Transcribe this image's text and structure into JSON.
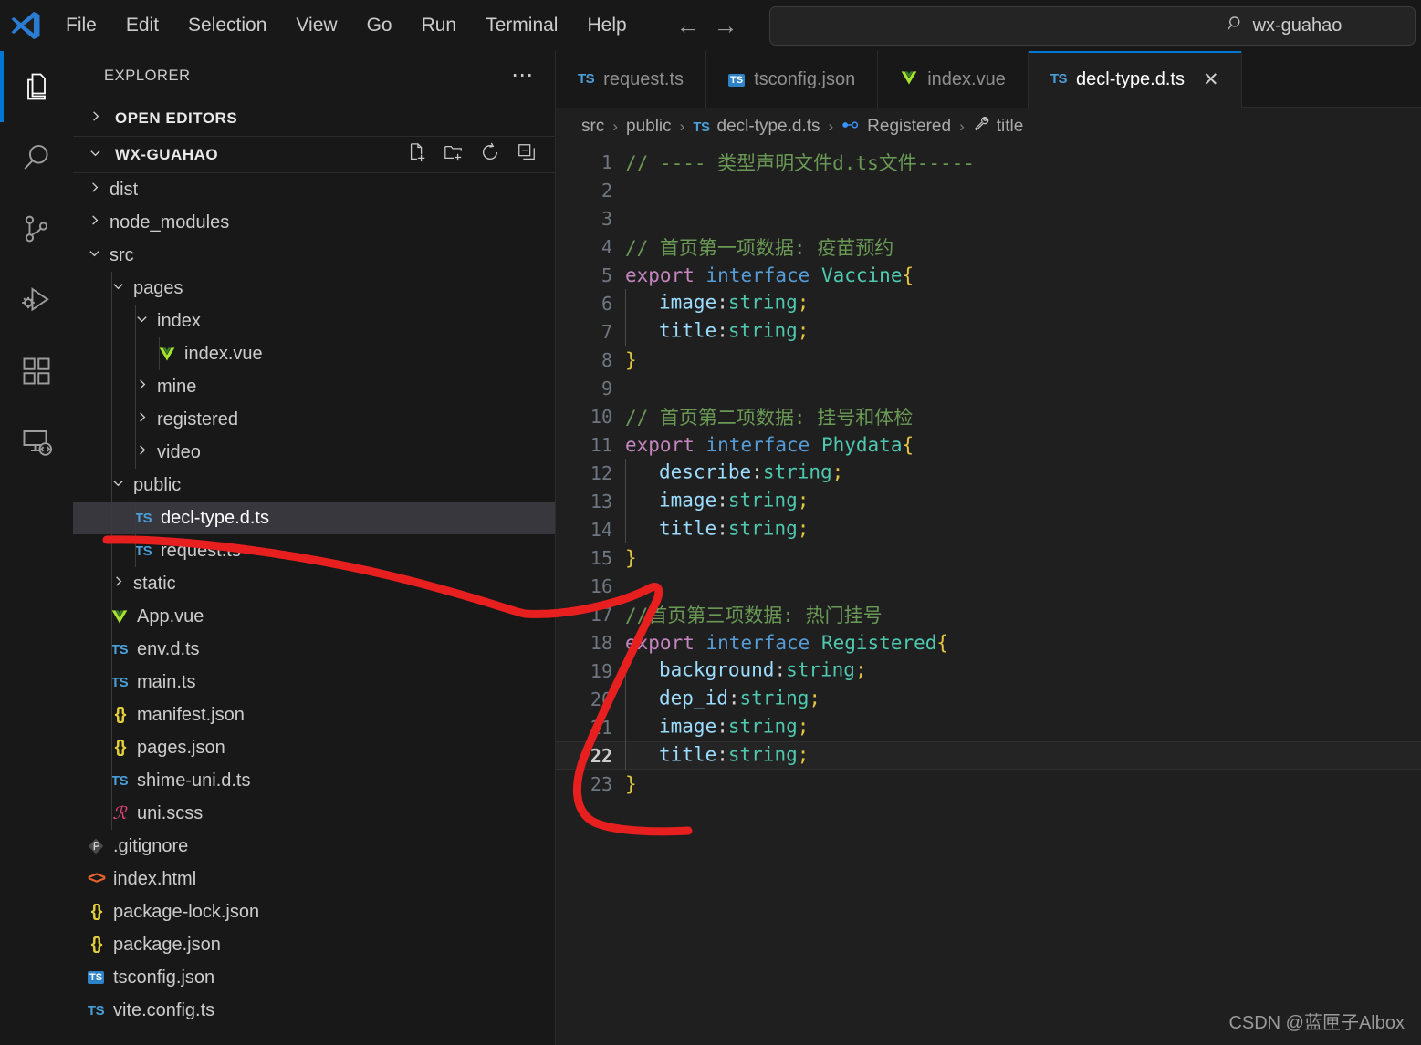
{
  "titlebar": {
    "logo_icon": "vscode-logo-icon",
    "menu": [
      "File",
      "Edit",
      "Selection",
      "View",
      "Go",
      "Run",
      "Terminal",
      "Help"
    ],
    "back_icon": "arrow-left-icon",
    "forward_icon": "arrow-right-icon",
    "search": {
      "icon": "search-icon",
      "value": "wx-guahao",
      "placeholder": "wx-guahao"
    }
  },
  "activitybar": {
    "items": [
      {
        "name": "explorer",
        "icon": "files-icon",
        "active": true
      },
      {
        "name": "search",
        "icon": "search-icon",
        "active": false
      },
      {
        "name": "source-control",
        "icon": "source-control-icon",
        "active": false
      },
      {
        "name": "run-and-debug",
        "icon": "run-debug-icon",
        "active": false
      },
      {
        "name": "extensions",
        "icon": "extensions-icon",
        "active": false
      },
      {
        "name": "remote-explorer",
        "icon": "remote-explorer-icon",
        "active": false
      }
    ]
  },
  "sidebar": {
    "title": "EXPLORER",
    "more_icon": "ellipsis-icon",
    "open_editors": {
      "label": "OPEN EDITORS",
      "expanded": false
    },
    "root": {
      "label": "WX-GUAHAO",
      "expanded": true,
      "actions": [
        {
          "name": "new-file",
          "icon": "new-file-icon"
        },
        {
          "name": "new-folder",
          "icon": "new-folder-icon"
        },
        {
          "name": "refresh",
          "icon": "refresh-icon"
        },
        {
          "name": "collapse-all",
          "icon": "collapse-all-icon"
        }
      ]
    },
    "tree": [
      {
        "label": "dist",
        "type": "folder",
        "expanded": false,
        "depth": 1
      },
      {
        "label": "node_modules",
        "type": "folder",
        "expanded": false,
        "depth": 1
      },
      {
        "label": "src",
        "type": "folder",
        "expanded": true,
        "depth": 1
      },
      {
        "label": "pages",
        "type": "folder",
        "expanded": true,
        "depth": 2
      },
      {
        "label": "index",
        "type": "folder",
        "expanded": true,
        "depth": 3
      },
      {
        "label": "index.vue",
        "type": "vue",
        "depth": 4
      },
      {
        "label": "mine",
        "type": "folder",
        "expanded": false,
        "depth": 3
      },
      {
        "label": "registered",
        "type": "folder",
        "expanded": false,
        "depth": 3
      },
      {
        "label": "video",
        "type": "folder",
        "expanded": false,
        "depth": 3
      },
      {
        "label": "public",
        "type": "folder",
        "expanded": true,
        "depth": 2
      },
      {
        "label": "decl-type.d.ts",
        "type": "ts",
        "depth": 3,
        "selected": true
      },
      {
        "label": "request.ts",
        "type": "ts",
        "depth": 3
      },
      {
        "label": "static",
        "type": "folder",
        "expanded": false,
        "depth": 2
      },
      {
        "label": "App.vue",
        "type": "vue",
        "depth": 2
      },
      {
        "label": "env.d.ts",
        "type": "ts",
        "depth": 2
      },
      {
        "label": "main.ts",
        "type": "ts",
        "depth": 2
      },
      {
        "label": "manifest.json",
        "type": "json",
        "depth": 2
      },
      {
        "label": "pages.json",
        "type": "json",
        "depth": 2
      },
      {
        "label": "shime-uni.d.ts",
        "type": "ts",
        "depth": 2
      },
      {
        "label": "uni.scss",
        "type": "scss",
        "depth": 2
      },
      {
        "label": ".gitignore",
        "type": "git",
        "depth": 1
      },
      {
        "label": "index.html",
        "type": "html",
        "depth": 1
      },
      {
        "label": "package-lock.json",
        "type": "json",
        "depth": 1
      },
      {
        "label": "package.json",
        "type": "json",
        "depth": 1
      },
      {
        "label": "tsconfig.json",
        "type": "tsjson",
        "depth": 1
      },
      {
        "label": "vite.config.ts",
        "type": "ts",
        "depth": 1
      }
    ]
  },
  "editor": {
    "tabs": [
      {
        "label": "request.ts",
        "icon": "ts-icon",
        "active": false,
        "closable": false
      },
      {
        "label": "tsconfig.json",
        "icon": "tsjson-icon",
        "active": false,
        "closable": false
      },
      {
        "label": "index.vue",
        "icon": "vue-icon",
        "active": false,
        "closable": false
      },
      {
        "label": "decl-type.d.ts",
        "icon": "ts-icon",
        "active": true,
        "closable": true,
        "close_icon": "close-icon"
      }
    ],
    "breadcrumb": [
      {
        "label": "src",
        "icon": null
      },
      {
        "label": "public",
        "icon": null
      },
      {
        "label": "decl-type.d.ts",
        "icon": "ts-icon"
      },
      {
        "label": "Registered",
        "icon": "interface-icon"
      },
      {
        "label": "title",
        "icon": "property-icon"
      }
    ],
    "active_line": 22,
    "lines": [
      {
        "n": 1,
        "tokens": [
          {
            "t": "// ---- 类型声明文件d.ts文件-----",
            "c": "c-com"
          }
        ]
      },
      {
        "n": 2,
        "tokens": []
      },
      {
        "n": 3,
        "tokens": []
      },
      {
        "n": 4,
        "tokens": [
          {
            "t": "// 首页第一项数据: 疫苗预约",
            "c": "c-com"
          }
        ]
      },
      {
        "n": 5,
        "tokens": [
          {
            "t": "export",
            "c": "c-kw"
          },
          {
            "t": " ",
            "c": "c-punct"
          },
          {
            "t": "interface",
            "c": "c-kw2"
          },
          {
            "t": " ",
            "c": "c-punct"
          },
          {
            "t": "Vaccine",
            "c": "c-type"
          },
          {
            "t": "{",
            "c": "c-brace"
          }
        ]
      },
      {
        "n": 6,
        "indent": 1,
        "tokens": [
          {
            "t": "image",
            "c": "c-prop"
          },
          {
            "t": ":",
            "c": "c-punct"
          },
          {
            "t": "string",
            "c": "c-str"
          },
          {
            "t": ";",
            "c": "c-brace"
          }
        ]
      },
      {
        "n": 7,
        "indent": 1,
        "tokens": [
          {
            "t": "title",
            "c": "c-prop"
          },
          {
            "t": ":",
            "c": "c-punct"
          },
          {
            "t": "string",
            "c": "c-str"
          },
          {
            "t": ";",
            "c": "c-brace"
          }
        ]
      },
      {
        "n": 8,
        "tokens": [
          {
            "t": "}",
            "c": "c-brace"
          }
        ]
      },
      {
        "n": 9,
        "tokens": []
      },
      {
        "n": 10,
        "tokens": [
          {
            "t": "// 首页第二项数据: 挂号和体检",
            "c": "c-com"
          }
        ]
      },
      {
        "n": 11,
        "tokens": [
          {
            "t": "export",
            "c": "c-kw"
          },
          {
            "t": " ",
            "c": "c-punct"
          },
          {
            "t": "interface",
            "c": "c-kw2"
          },
          {
            "t": " ",
            "c": "c-punct"
          },
          {
            "t": "Phydata",
            "c": "c-type"
          },
          {
            "t": "{",
            "c": "c-brace"
          }
        ]
      },
      {
        "n": 12,
        "indent": 1,
        "tokens": [
          {
            "t": "describe",
            "c": "c-prop"
          },
          {
            "t": ":",
            "c": "c-punct"
          },
          {
            "t": "string",
            "c": "c-str"
          },
          {
            "t": ";",
            "c": "c-brace"
          }
        ]
      },
      {
        "n": 13,
        "indent": 1,
        "tokens": [
          {
            "t": "image",
            "c": "c-prop"
          },
          {
            "t": ":",
            "c": "c-punct"
          },
          {
            "t": "string",
            "c": "c-str"
          },
          {
            "t": ";",
            "c": "c-brace"
          }
        ]
      },
      {
        "n": 14,
        "indent": 1,
        "tokens": [
          {
            "t": "title",
            "c": "c-prop"
          },
          {
            "t": ":",
            "c": "c-punct"
          },
          {
            "t": "string",
            "c": "c-str"
          },
          {
            "t": ";",
            "c": "c-brace"
          }
        ]
      },
      {
        "n": 15,
        "tokens": [
          {
            "t": "}",
            "c": "c-brace"
          }
        ]
      },
      {
        "n": 16,
        "tokens": []
      },
      {
        "n": 17,
        "tokens": [
          {
            "t": "//首页第三项数据: 热门挂号",
            "c": "c-com"
          }
        ]
      },
      {
        "n": 18,
        "tokens": [
          {
            "t": "export",
            "c": "c-kw"
          },
          {
            "t": " ",
            "c": "c-punct"
          },
          {
            "t": "interface",
            "c": "c-kw2"
          },
          {
            "t": " ",
            "c": "c-punct"
          },
          {
            "t": "Registered",
            "c": "c-type"
          },
          {
            "t": "{",
            "c": "c-brace"
          }
        ]
      },
      {
        "n": 19,
        "indent": 1,
        "tokens": [
          {
            "t": "background",
            "c": "c-prop"
          },
          {
            "t": ":",
            "c": "c-punct"
          },
          {
            "t": "string",
            "c": "c-str"
          },
          {
            "t": ";",
            "c": "c-brace"
          }
        ]
      },
      {
        "n": 20,
        "indent": 1,
        "tokens": [
          {
            "t": "dep_id",
            "c": "c-prop"
          },
          {
            "t": ":",
            "c": "c-punct"
          },
          {
            "t": "string",
            "c": "c-str"
          },
          {
            "t": ";",
            "c": "c-brace"
          }
        ]
      },
      {
        "n": 21,
        "indent": 1,
        "tokens": [
          {
            "t": "image",
            "c": "c-prop"
          },
          {
            "t": ":",
            "c": "c-punct"
          },
          {
            "t": "string",
            "c": "c-str"
          },
          {
            "t": ";",
            "c": "c-brace"
          }
        ]
      },
      {
        "n": 22,
        "indent": 1,
        "tokens": [
          {
            "t": "title",
            "c": "c-prop"
          },
          {
            "t": ":",
            "c": "c-punct"
          },
          {
            "t": "string",
            "c": "c-str"
          },
          {
            "t": ";",
            "c": "c-brace"
          }
        ]
      },
      {
        "n": 23,
        "tokens": [
          {
            "t": "}",
            "c": "c-brace"
          }
        ]
      }
    ]
  },
  "annotation": {
    "name": "red-pen-highlight",
    "color": "#e81f1f"
  },
  "watermark": "CSDN @蓝匣子Albox",
  "colors": {
    "accent": "#0078d4",
    "editor_bg": "#1f1f1f",
    "sidebar_bg": "#181818",
    "selection_bg": "#37373d",
    "annotation_red": "#e81f1f"
  }
}
